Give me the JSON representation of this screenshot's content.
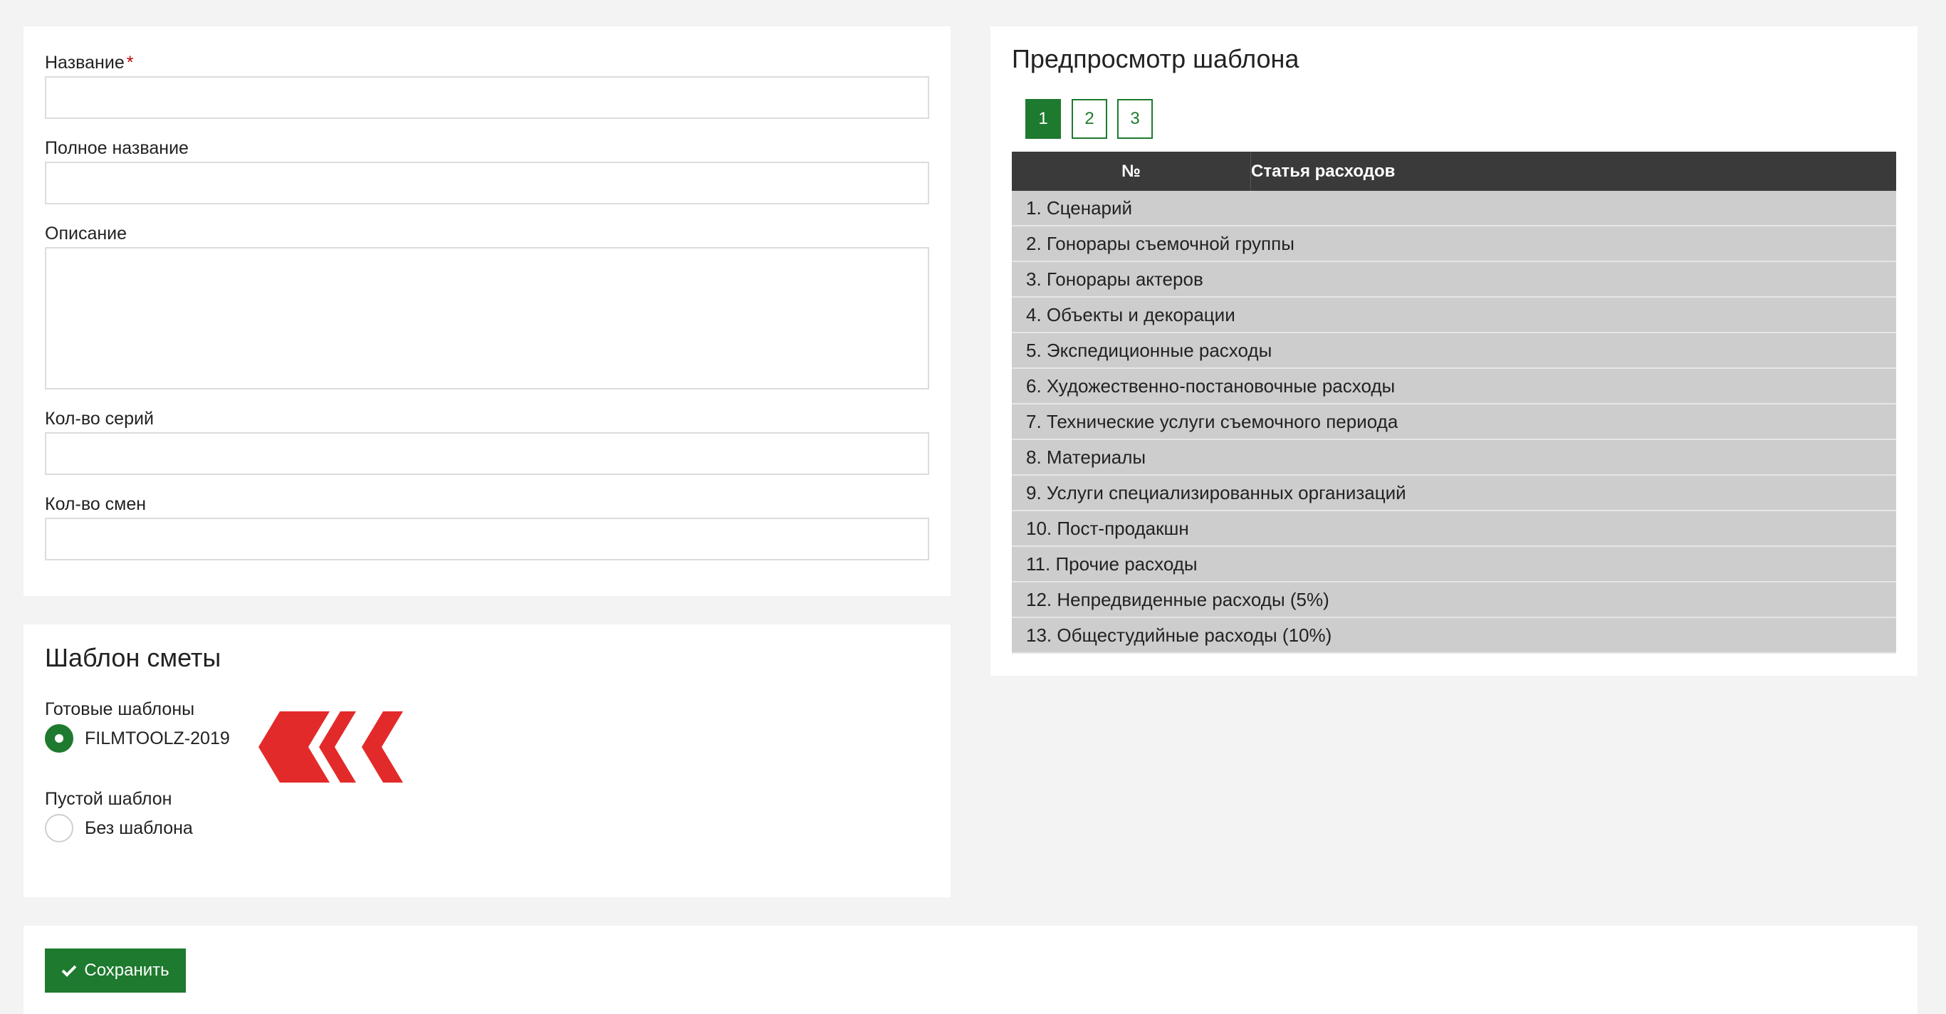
{
  "form": {
    "name_label": "Название",
    "required_mark": "*",
    "full_name_label": "Полное название",
    "description_label": "Описание",
    "series_count_label": "Кол-во серий",
    "shifts_count_label": "Кол-во смен",
    "name_value": "",
    "full_name_value": "",
    "description_value": "",
    "series_count_value": "",
    "shifts_count_value": ""
  },
  "template": {
    "title": "Шаблон сметы",
    "ready_label": "Готовые шаблоны",
    "ready_option": "FILMTOOLZ-2019",
    "ready_selected": true,
    "empty_label": "Пустой шаблон",
    "empty_option": "Без шаблона",
    "empty_selected": false,
    "arrow_color": "#e32a2a"
  },
  "preview": {
    "title": "Предпросмотр шаблона",
    "pages": [
      "1",
      "2",
      "3"
    ],
    "active_page": "1",
    "columns": {
      "num": "№",
      "item": "Статья расходов"
    },
    "rows": [
      "1. Сценарий",
      "2. Гонорары съемочной группы",
      "3. Гонорары актеров",
      "4. Объекты и декорации",
      "5. Экспедиционные расходы",
      "6. Художественно-постановочные расходы",
      "7. Технические услуги съемочного периода",
      "8. Материалы",
      "9. Услуги специализированных организаций",
      "10. Пост-продакшн",
      "11. Прочие расходы",
      "12. Непредвиденные расходы (5%)",
      "13. Общестудийные расходы (10%)"
    ]
  },
  "actions": {
    "save_label": "Сохранить",
    "save_icon": "check-icon"
  },
  "colors": {
    "accent": "#1e7a2e",
    "table_header": "#3a3a3a",
    "row_bg": "#cdcdcd",
    "required": "#c00000"
  }
}
